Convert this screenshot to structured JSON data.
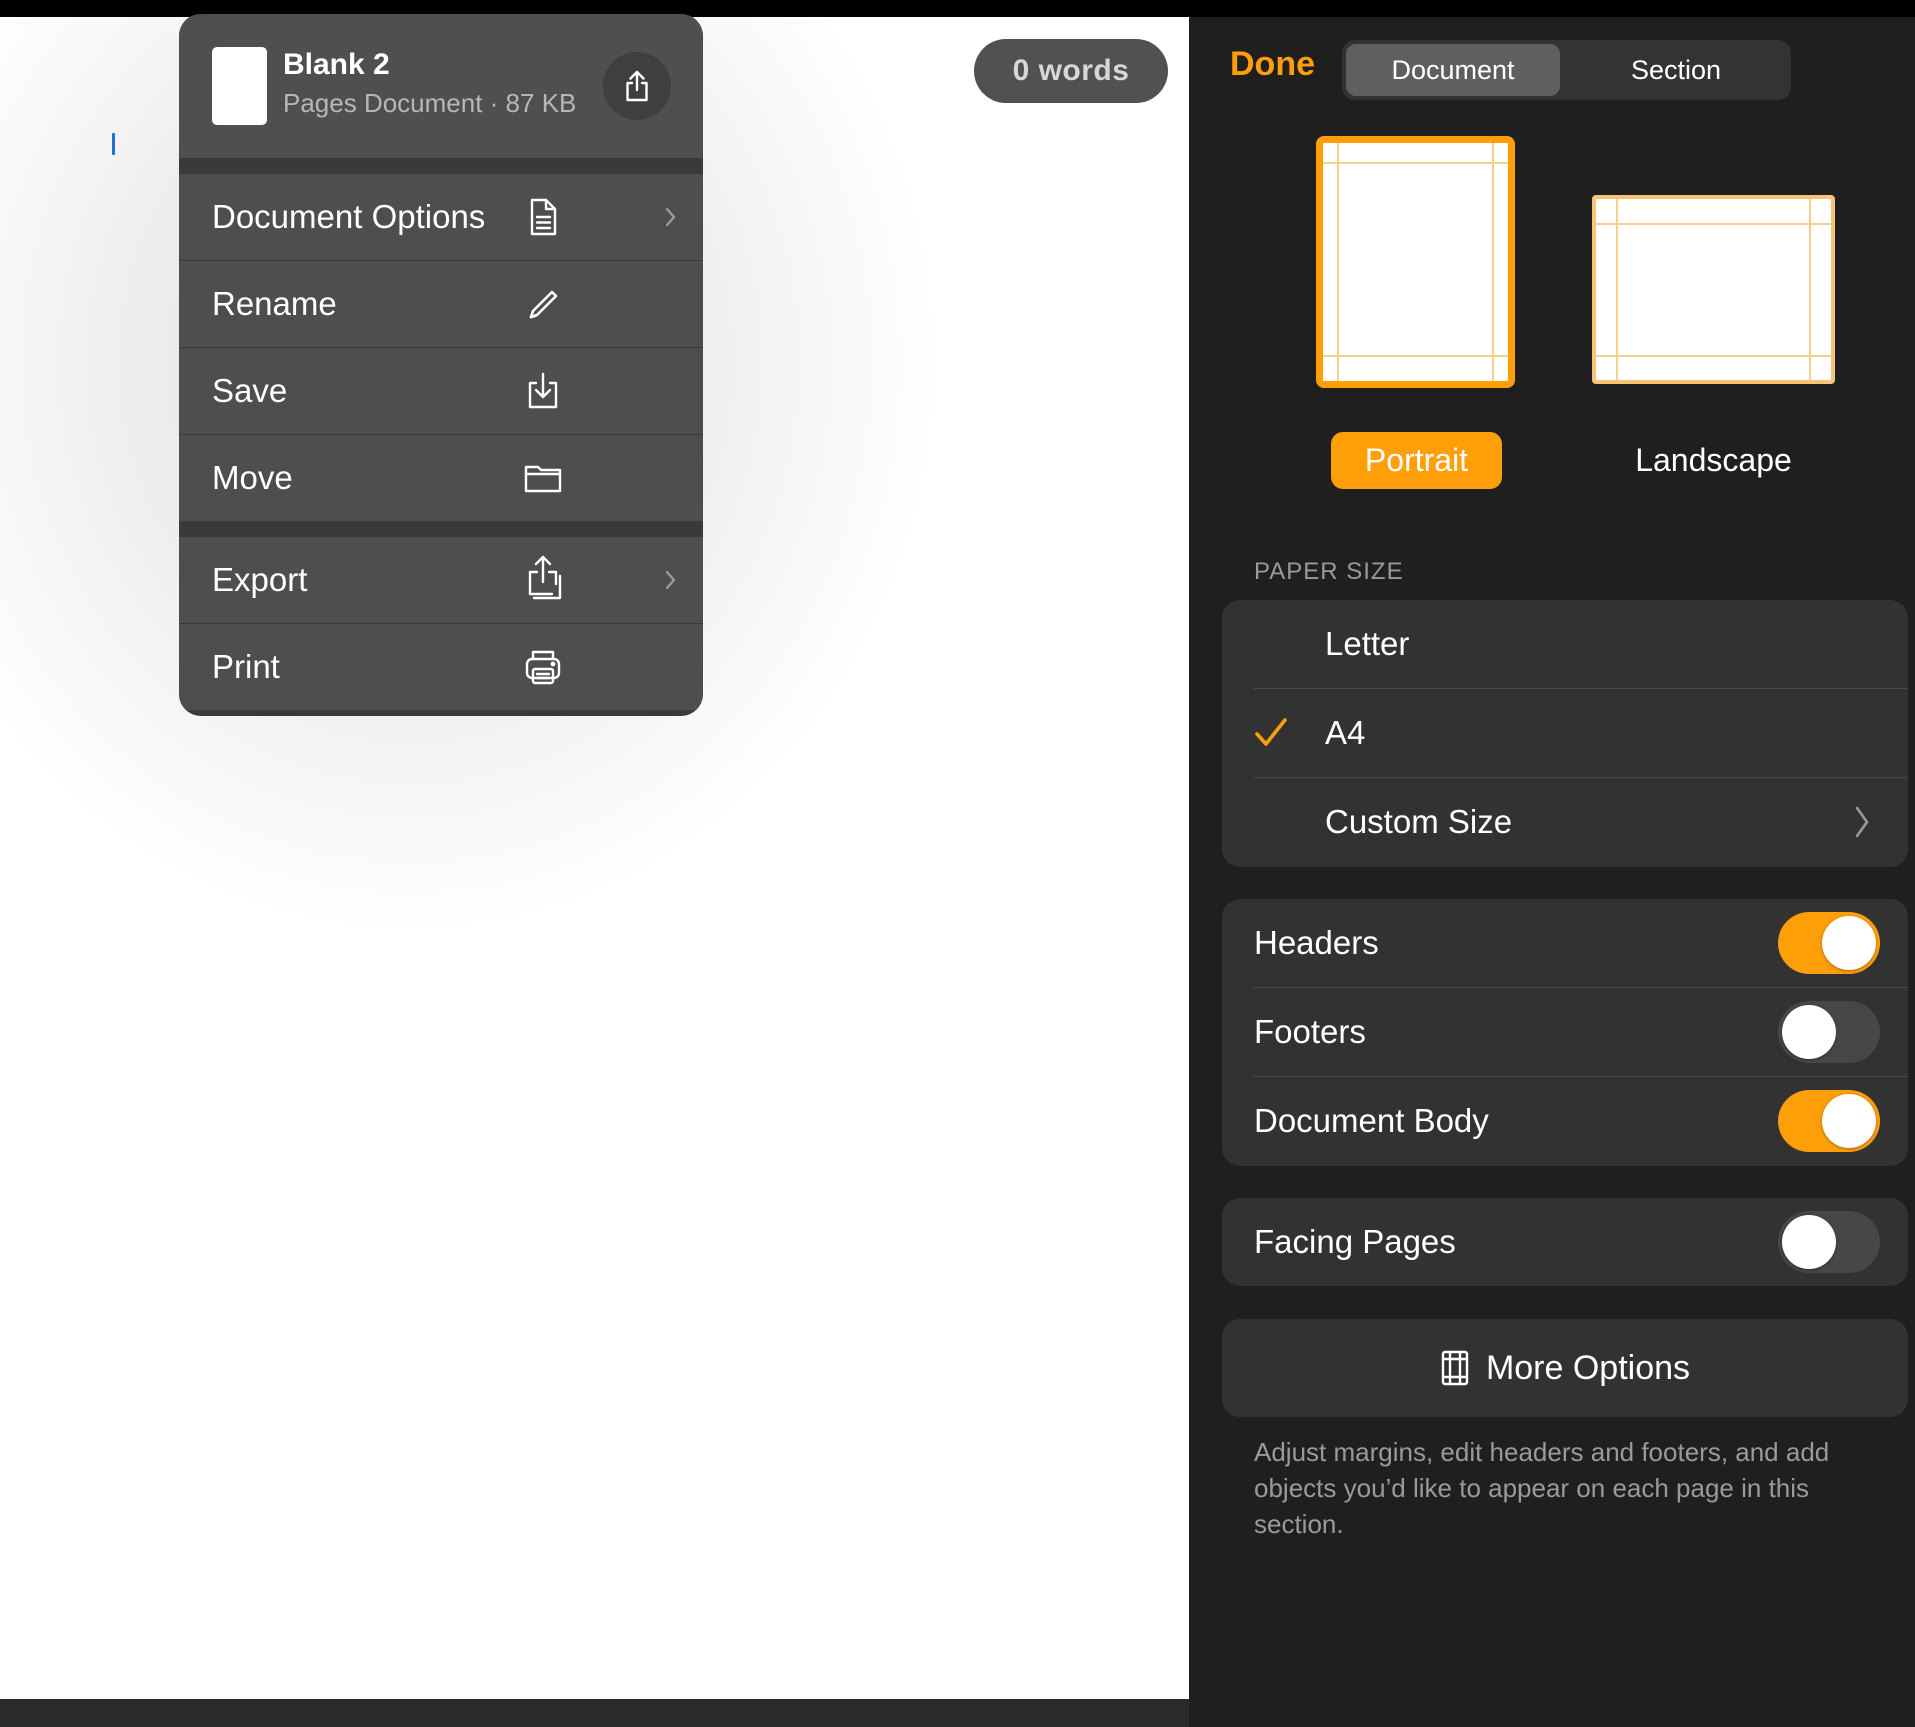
{
  "document_area": {
    "word_count": "0 words"
  },
  "file_menu": {
    "document_name": "Blank 2",
    "document_meta": "Pages Document · 87 KB",
    "items": [
      {
        "label": "Document Options",
        "icon": "document-icon",
        "has_submenu": true
      },
      {
        "label": "Rename",
        "icon": "pencil-icon",
        "has_submenu": false
      },
      {
        "label": "Save",
        "icon": "save-download-icon",
        "has_submenu": false
      },
      {
        "label": "Move",
        "icon": "folder-icon",
        "has_submenu": false
      },
      {
        "label": "Export",
        "icon": "share-export-icon",
        "has_submenu": true
      },
      {
        "label": "Print",
        "icon": "printer-icon",
        "has_submenu": false
      }
    ]
  },
  "inspector": {
    "done_label": "Done",
    "tabs": [
      {
        "label": "Document",
        "selected": true
      },
      {
        "label": "Section",
        "selected": false
      }
    ],
    "orientation": {
      "portrait_label": "Portrait",
      "landscape_label": "Landscape",
      "selected": "Portrait"
    },
    "paper_size": {
      "heading": "PAPER SIZE",
      "options": [
        {
          "label": "Letter",
          "selected": false
        },
        {
          "label": "A4",
          "selected": true
        },
        {
          "label": "Custom Size",
          "selected": false,
          "has_submenu": true
        }
      ]
    },
    "toggles": [
      {
        "label": "Headers",
        "on": true
      },
      {
        "label": "Footers",
        "on": false
      },
      {
        "label": "Document Body",
        "on": true
      }
    ],
    "facing_pages": {
      "label": "Facing Pages",
      "on": false
    },
    "more_options": {
      "label": "More Options",
      "description": "Adjust margins, edit headers and footers, and add objects you’d like to appear on each page in this section."
    }
  },
  "colors": {
    "accent": "#fe9f0a",
    "panel_bg": "#1f1f1f",
    "group_bg": "#323232",
    "menu_bg": "#4e4e4e"
  }
}
